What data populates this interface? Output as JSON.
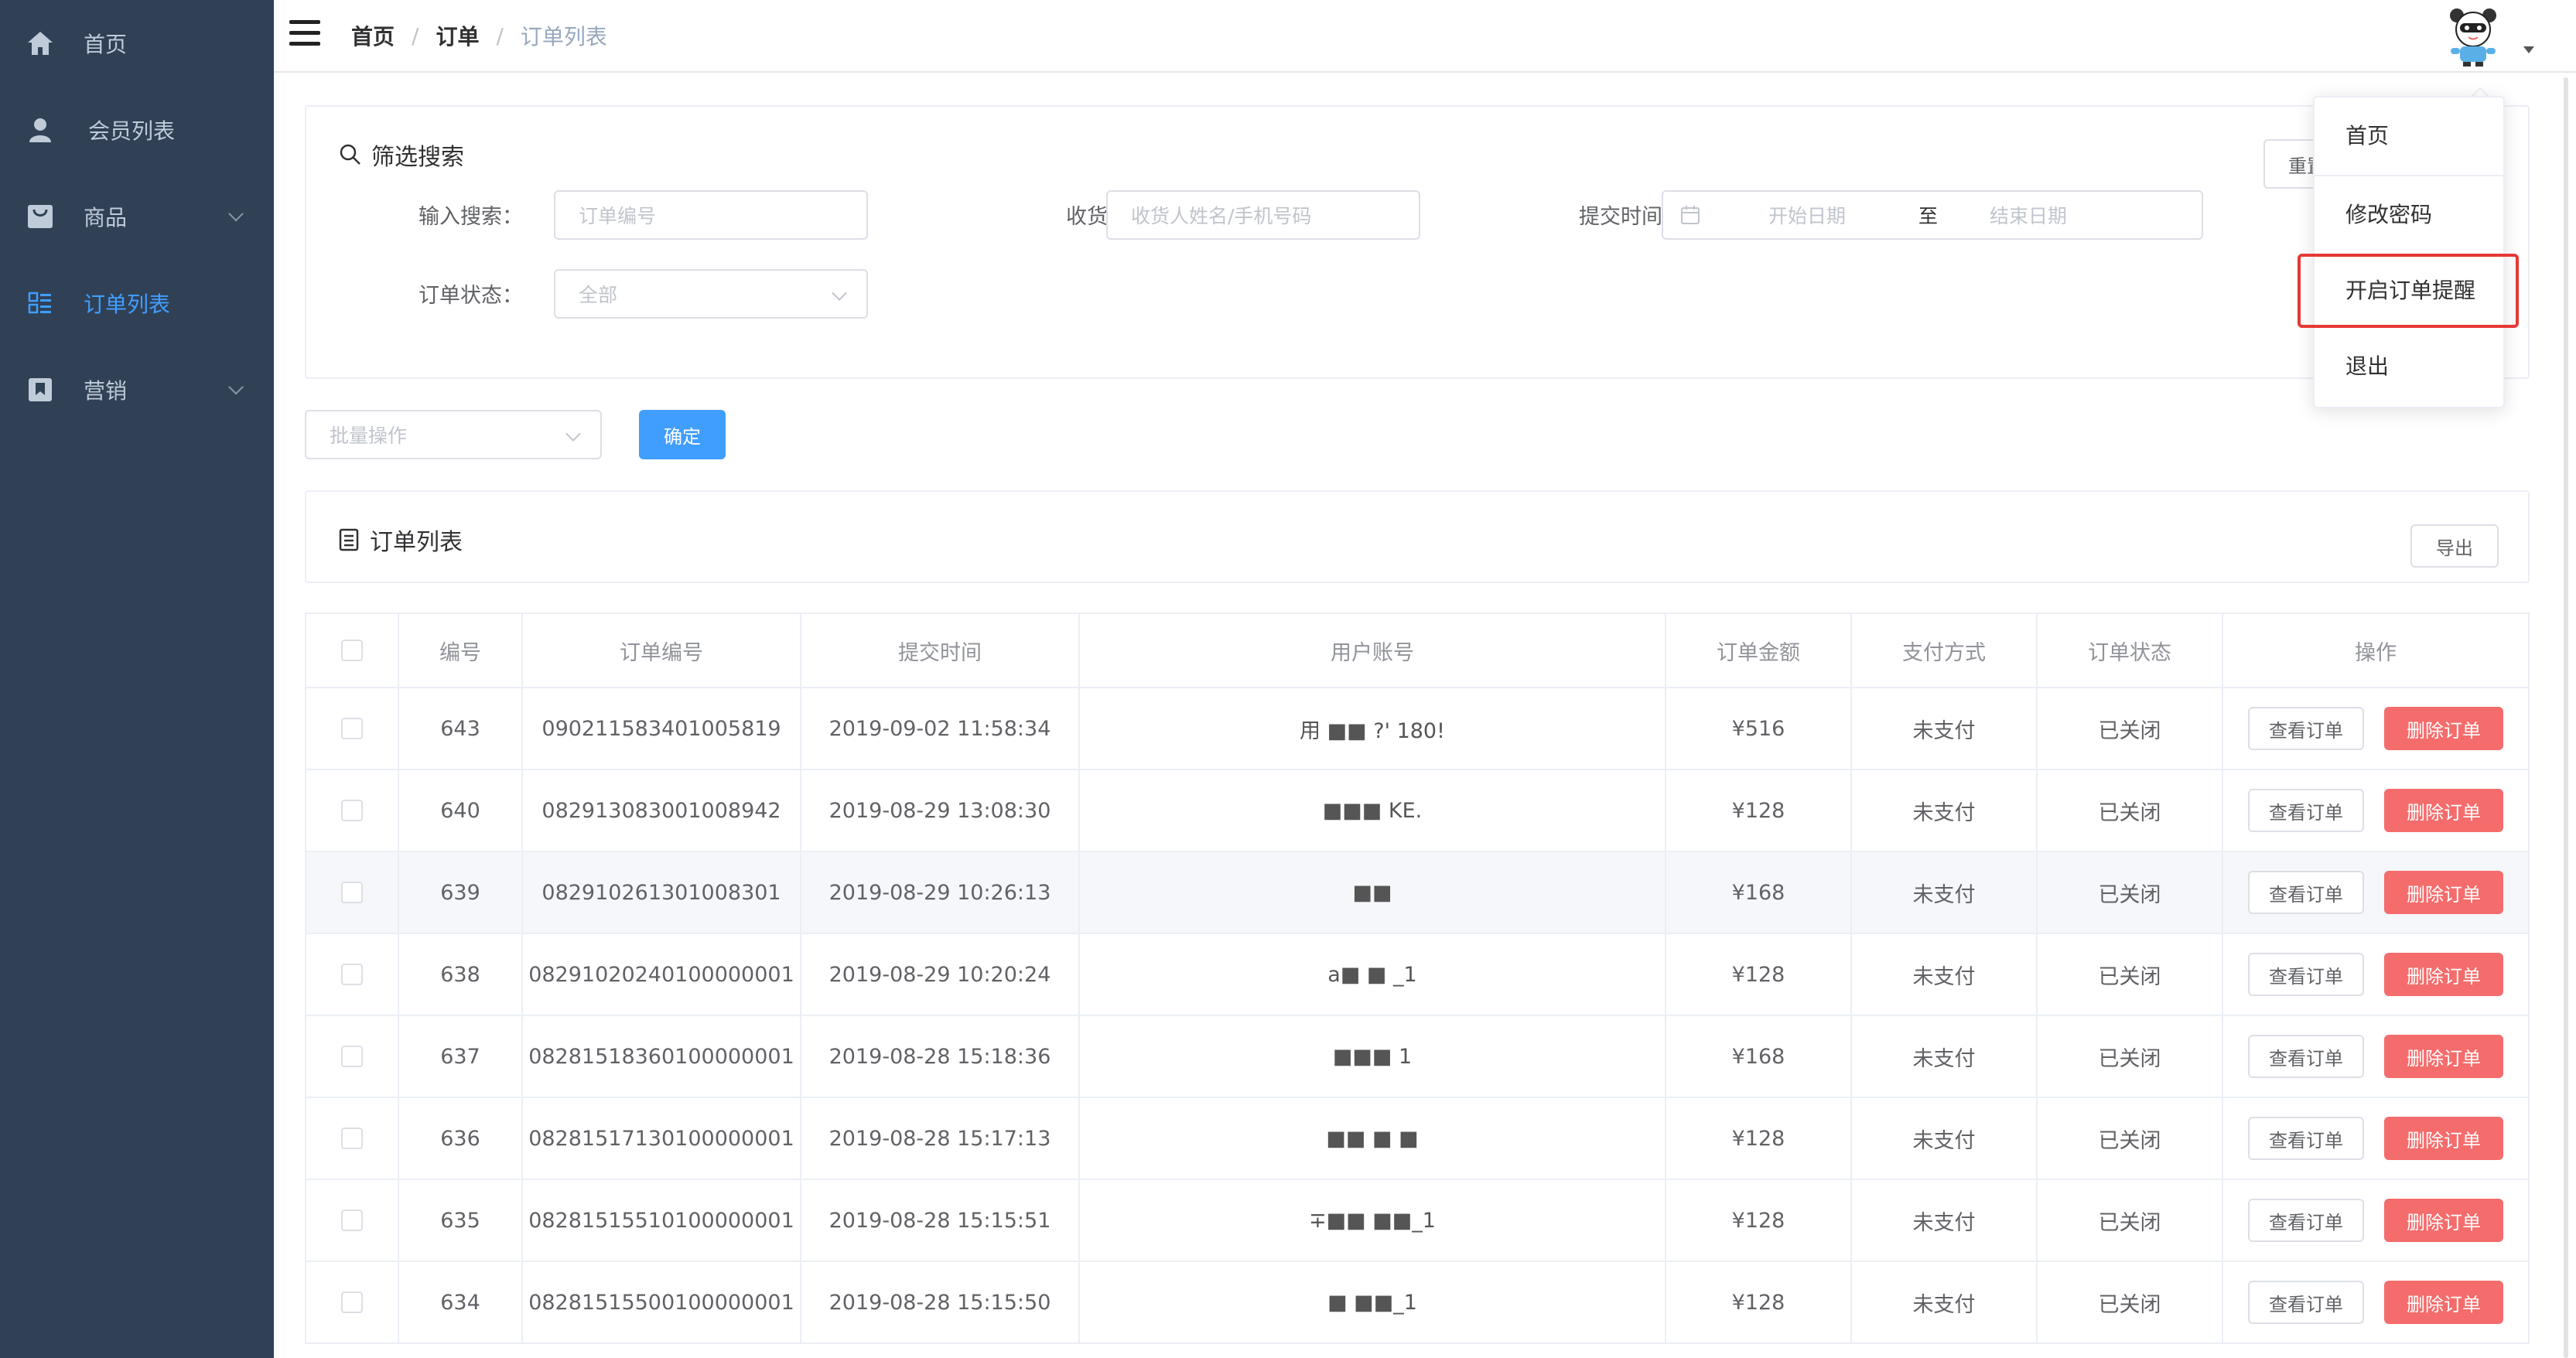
{
  "sidebar": {
    "items": [
      {
        "label": "首页",
        "icon": "home-icon"
      },
      {
        "label": "会员列表",
        "icon": "user-icon"
      },
      {
        "label": "商品",
        "icon": "shopping-bag-icon",
        "expandable": true
      },
      {
        "label": "订单列表",
        "icon": "list-icon",
        "active": true
      },
      {
        "label": "营销",
        "icon": "bookmark-icon",
        "expandable": true
      }
    ],
    "colors": {
      "background": "#304156",
      "text": "#bfcbd9",
      "active": "#409eff"
    }
  },
  "header": {
    "breadcrumb": [
      "首页",
      "订单",
      "订单列表"
    ]
  },
  "user_dropdown": {
    "items": [
      "首页",
      "修改密码",
      "开启订单提醒",
      "退出"
    ],
    "highlighted": "开启订单提醒"
  },
  "filter": {
    "title": "筛选搜索",
    "reset_label": "重置",
    "keyword": {
      "label": "输入搜索：",
      "placeholder": "订单编号"
    },
    "receiver": {
      "label": "收货人：",
      "placeholder": "收货人姓名/手机号码"
    },
    "submit_time": {
      "label": "提交时间：",
      "start_placeholder": "开始日期",
      "separator": "至",
      "end_placeholder": "结束日期"
    },
    "status": {
      "label": "订单状态：",
      "placeholder": "全部"
    }
  },
  "batch": {
    "placeholder": "批量操作",
    "confirm_label": "确定"
  },
  "list": {
    "title": "订单列表",
    "export_label": "导出",
    "columns": [
      "编号",
      "订单编号",
      "提交时间",
      "用户账号",
      "订单金额",
      "支付方式",
      "订单状态",
      "操作"
    ],
    "view_label": "查看订单",
    "delete_label": "删除订单",
    "rows": [
      {
        "id": "643",
        "order_no": "090211583401005819",
        "time": "2019-09-02 11:58:34",
        "account": "用 ■■ ?' 180!",
        "amount": "¥516",
        "pay": "未支付",
        "status": "已关闭"
      },
      {
        "id": "640",
        "order_no": "082913083001008942",
        "time": "2019-08-29 13:08:30",
        "account": "■■■ KE.",
        "amount": "¥128",
        "pay": "未支付",
        "status": "已关闭"
      },
      {
        "id": "639",
        "order_no": "082910261301008301",
        "time": "2019-08-29 10:26:13",
        "account": "■■",
        "amount": "¥168",
        "pay": "未支付",
        "status": "已关闭"
      },
      {
        "id": "638",
        "order_no": "08291020240100000001",
        "time": "2019-08-29 10:20:24",
        "account": "a■ ■ _1",
        "amount": "¥128",
        "pay": "未支付",
        "status": "已关闭"
      },
      {
        "id": "637",
        "order_no": "08281518360100000001",
        "time": "2019-08-28 15:18:36",
        "account": "■■■ 1",
        "amount": "¥168",
        "pay": "未支付",
        "status": "已关闭"
      },
      {
        "id": "636",
        "order_no": "08281517130100000001",
        "time": "2019-08-28 15:17:13",
        "account": "■■ ■ ■",
        "amount": "¥128",
        "pay": "未支付",
        "status": "已关闭"
      },
      {
        "id": "635",
        "order_no": "08281515510100000001",
        "time": "2019-08-28 15:15:51",
        "account": "∓■■ ■■_1",
        "amount": "¥128",
        "pay": "未支付",
        "status": "已关闭"
      },
      {
        "id": "634",
        "order_no": "08281515500100000001",
        "time": "2019-08-28 15:15:50",
        "account": "■ ■■_1",
        "amount": "¥128",
        "pay": "未支付",
        "status": "已关闭"
      }
    ],
    "hover_row_index": 2
  },
  "colors": {
    "primary": "#409eff",
    "danger": "#f56c6c",
    "highlight_border": "#e53935"
  }
}
